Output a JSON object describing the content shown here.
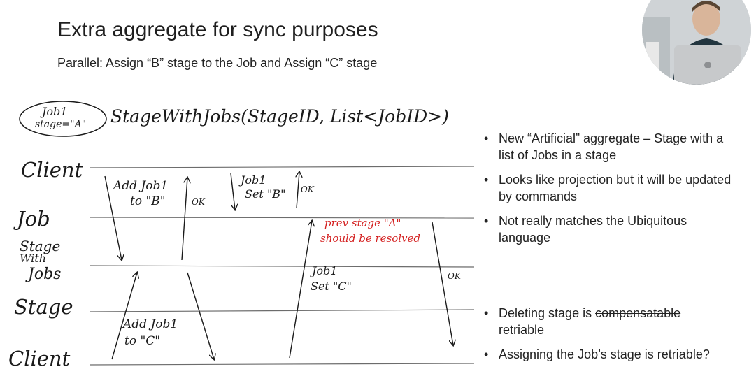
{
  "slide": {
    "title": "Extra aggregate for sync purposes",
    "subtitle": "Parallel: Assign “B” stage to the Job and Assign “C” stage"
  },
  "diagram": {
    "job_state_line1": "Job1",
    "job_state_line2": "stage=\"A\"",
    "aggregate_signature": "StageWithJobs(StageID, List<JobID>)",
    "lanes": {
      "client_top": "Client",
      "job": "Job",
      "stage_with_jobs_1": "Stage",
      "stage_with_jobs_2": "With",
      "stage_with_jobs_3": "Jobs",
      "stage": "Stage",
      "client_bottom": "Client"
    },
    "messages": {
      "add_job_b_1": "Add Job1",
      "add_job_b_2": "to \"B\"",
      "ok_1": "OK",
      "set_b_1": "Job1",
      "set_b_2": "Set \"B\"",
      "ok_2": "OK",
      "prev_stage_1": "prev stage \"A\"",
      "prev_stage_2": "should be resolved",
      "set_c_1": "Job1",
      "set_c_2": "Set \"C\"",
      "ok_3": "OK",
      "add_job_c_1": "Add Job1",
      "add_job_c_2": "to \"C\""
    },
    "colors": {
      "ink": "#1a1a1a",
      "annotation": "#d42020",
      "lane": "#6c6c6c"
    }
  },
  "bullets_top": [
    {
      "text": "New “Artificial” aggregate – Stage with a list of Jobs in a stage"
    },
    {
      "text": "Looks like projection but it will be updated by commands"
    },
    {
      "text": "Not really matches the Ubiquitous language"
    }
  ],
  "bullets_bottom": {
    "item1_prefix": "Deleting stage is ",
    "item1_struck": "compensatable",
    "item1_suffix": "retriable",
    "item2": "Assigning the Job’s stage is retriable?"
  },
  "bullet_symbol": "•"
}
